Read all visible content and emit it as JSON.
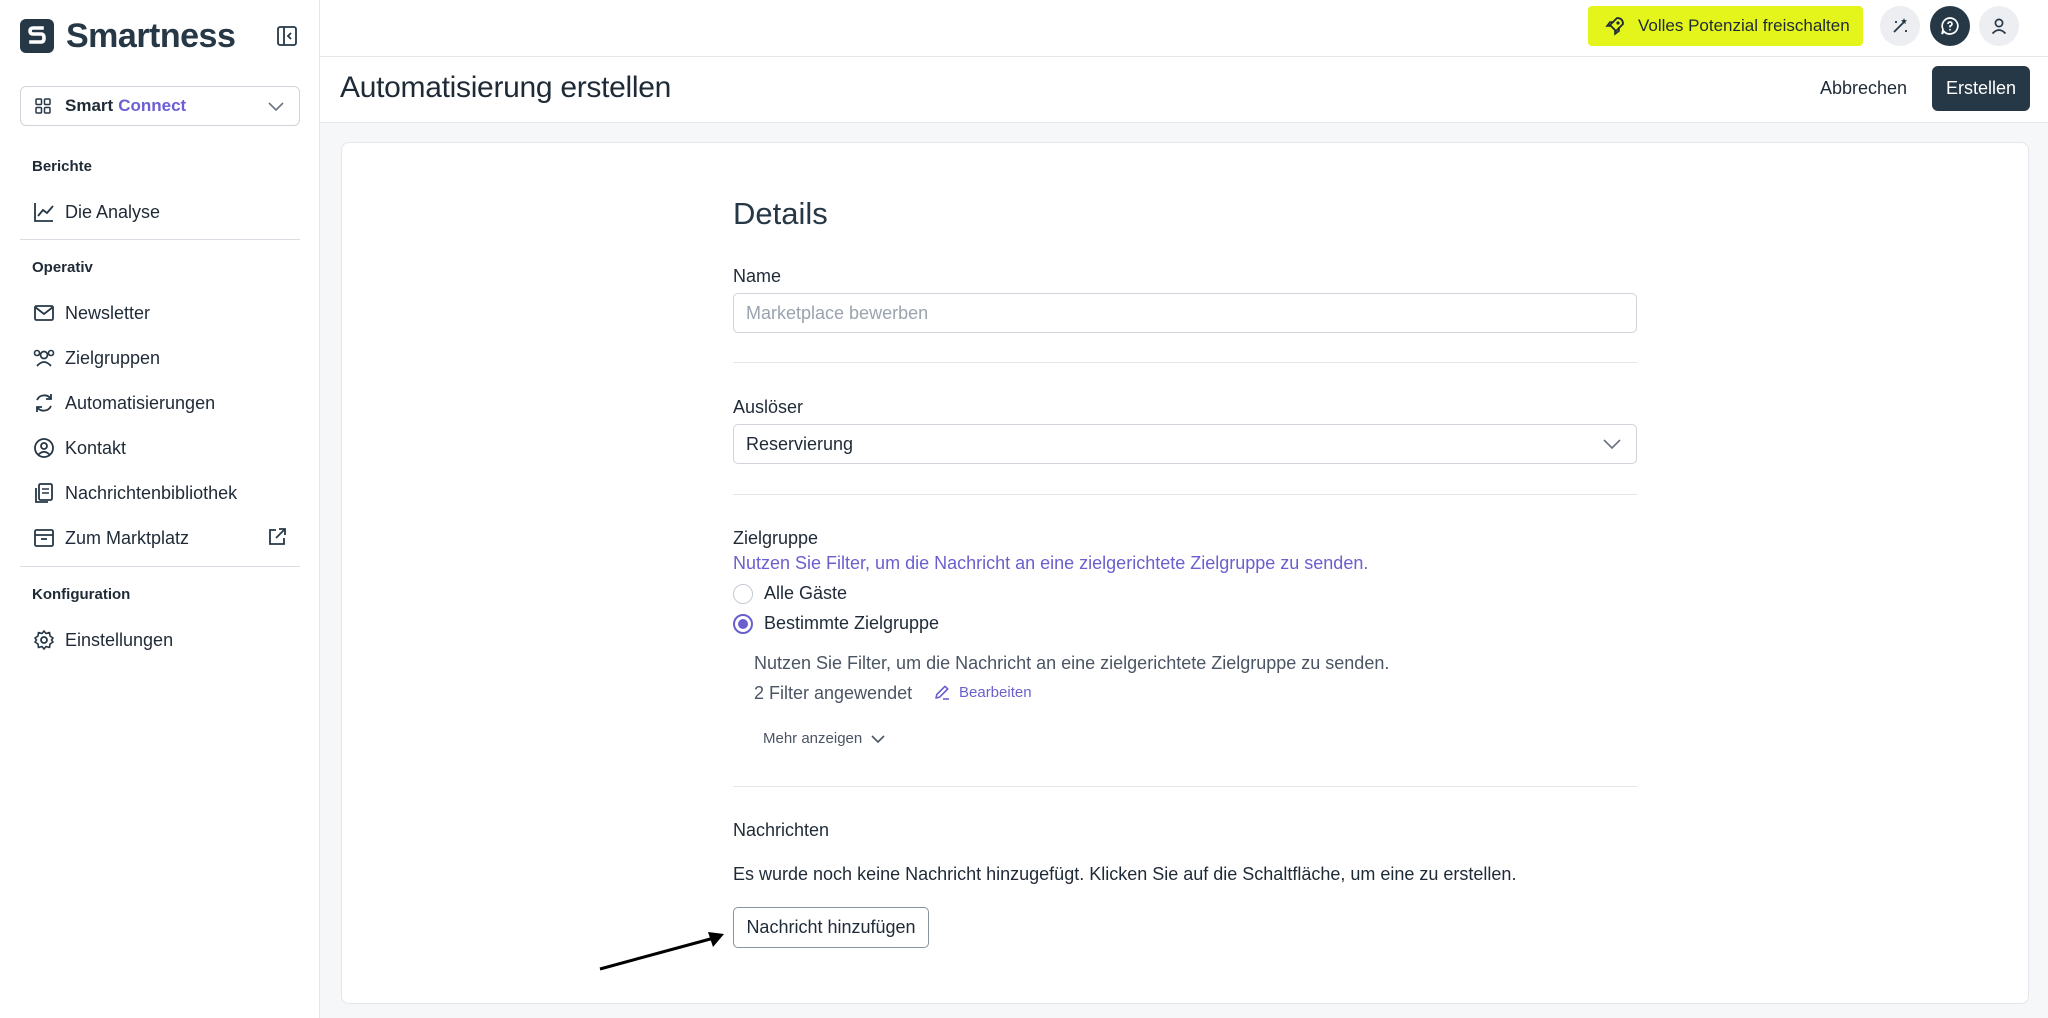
{
  "brand": {
    "name": "Smartness"
  },
  "app_switcher": {
    "label_primary": "Smart",
    "label_secondary": "Connect"
  },
  "sidebar": {
    "sections": [
      {
        "title": "Berichte"
      },
      {
        "title": "Operativ"
      },
      {
        "title": "Konfiguration"
      }
    ],
    "items": [
      {
        "label": "Die Analyse",
        "icon": "chart-line-icon"
      },
      {
        "label": "Newsletter",
        "icon": "mail-icon"
      },
      {
        "label": "Zielgruppen",
        "icon": "users-icon"
      },
      {
        "label": "Automatisierungen",
        "icon": "refresh-icon"
      },
      {
        "label": "Kontakt",
        "icon": "user-circle-icon"
      },
      {
        "label": "Nachrichtenbibliothek",
        "icon": "library-icon"
      },
      {
        "label": "Zum Marktplatz",
        "icon": "inbox-icon"
      },
      {
        "label": "Einstellungen",
        "icon": "gear-icon"
      }
    ]
  },
  "topbar": {
    "upgrade_label": "Volles Potenzial freischalten",
    "accent_color": "#e4f51c"
  },
  "page": {
    "title": "Automatisierung erstellen",
    "cancel_label": "Abbrechen",
    "create_label": "Erstellen"
  },
  "form": {
    "details_heading": "Details",
    "name_label": "Name",
    "name_placeholder": "Marketplace bewerben",
    "name_value": "",
    "trigger_label": "Auslöser",
    "trigger_value": "Reservierung",
    "audience_label": "Zielgruppe",
    "audience_helper": "Nutzen Sie Filter, um die Nachricht an eine zielgerichtete Zielgruppe zu senden.",
    "audience_options": [
      {
        "label": "Alle Gäste",
        "selected": false
      },
      {
        "label": "Bestimmte Zielgruppe",
        "selected": true
      }
    ],
    "filter_hint": "Nutzen Sie Filter, um die Nachricht an eine zielgerichtete Zielgruppe zu senden.",
    "filters_applied": "2 Filter angewendet",
    "edit_label": "Bearbeiten",
    "more_label": "Mehr anzeigen",
    "messages_heading": "Nachrichten",
    "messages_empty": "Es wurde noch keine Nachricht hinzugefügt. Klicken Sie auf die Schaltfläche, um eine zu erstellen.",
    "add_message_label": "Nachricht hinzufügen"
  },
  "colors": {
    "brand_dark": "#263746",
    "accent_purple": "#6a5fcf"
  }
}
